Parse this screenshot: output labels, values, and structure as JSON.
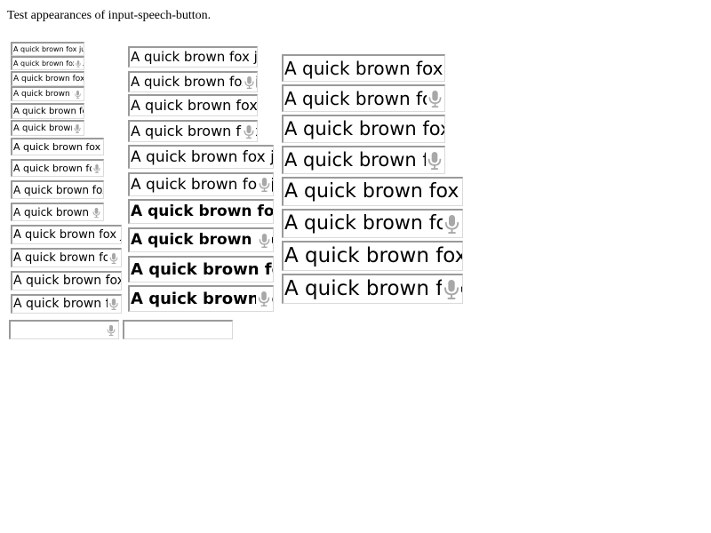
{
  "page": {
    "heading": "Test appearances of input-speech-button."
  },
  "fields": [
    {
      "value": "A quick brown fox jumps",
      "speech": false
    },
    {
      "value": "A quick brown fox jum",
      "speech": true
    },
    {
      "value": "A quick brown fox j",
      "speech": false
    },
    {
      "value": "A quick brown fo",
      "speech": true
    },
    {
      "value": "A quick brown fox",
      "speech": false
    },
    {
      "value": "A quick brown",
      "speech": true
    },
    {
      "value": "A quick brown fox ju",
      "speech": false
    },
    {
      "value": "A quick brown fox",
      "speech": true
    },
    {
      "value": "A quick brown fox j",
      "speech": false
    },
    {
      "value": "A quick brown fo",
      "speech": true
    },
    {
      "value": "A quick brown fox jum",
      "speech": false
    },
    {
      "value": "A quick brown fox",
      "speech": true
    },
    {
      "value": "A quick brown fox ju",
      "speech": false
    },
    {
      "value": "A quick brown fo",
      "speech": true
    },
    {
      "value": "",
      "speech": true
    },
    {
      "value": "",
      "speech": false
    },
    {
      "value": "A quick brown fox jum",
      "speech": false
    },
    {
      "value": "A quick brown fox j",
      "speech": true
    },
    {
      "value": "A quick brown fox jum",
      "speech": false
    },
    {
      "value": "A quick brown fox",
      "speech": true
    },
    {
      "value": "A quick brown fox jum",
      "speech": false
    },
    {
      "value": "A quick brown fox j",
      "speech": true
    },
    {
      "value": "A quick brown fox ju",
      "speech": false
    },
    {
      "value": "A quick brown fox",
      "speech": true
    },
    {
      "value": "A quick brown fox ju",
      "speech": false
    },
    {
      "value": "A quick brown fo",
      "speech": true
    },
    {
      "value": "A quick brown fox jur",
      "speech": false
    },
    {
      "value": "A quick brown fox",
      "speech": true
    },
    {
      "value": "A quick brown fox ju",
      "speech": false
    },
    {
      "value": "A quick brown fo",
      "speech": true
    },
    {
      "value": "A quick brown fox jun",
      "speech": false
    },
    {
      "value": "A quick brown fox",
      "speech": true
    },
    {
      "value": "A quick brown fox jur",
      "speech": false
    },
    {
      "value": "A quick brown fox",
      "speech": true
    }
  ]
}
